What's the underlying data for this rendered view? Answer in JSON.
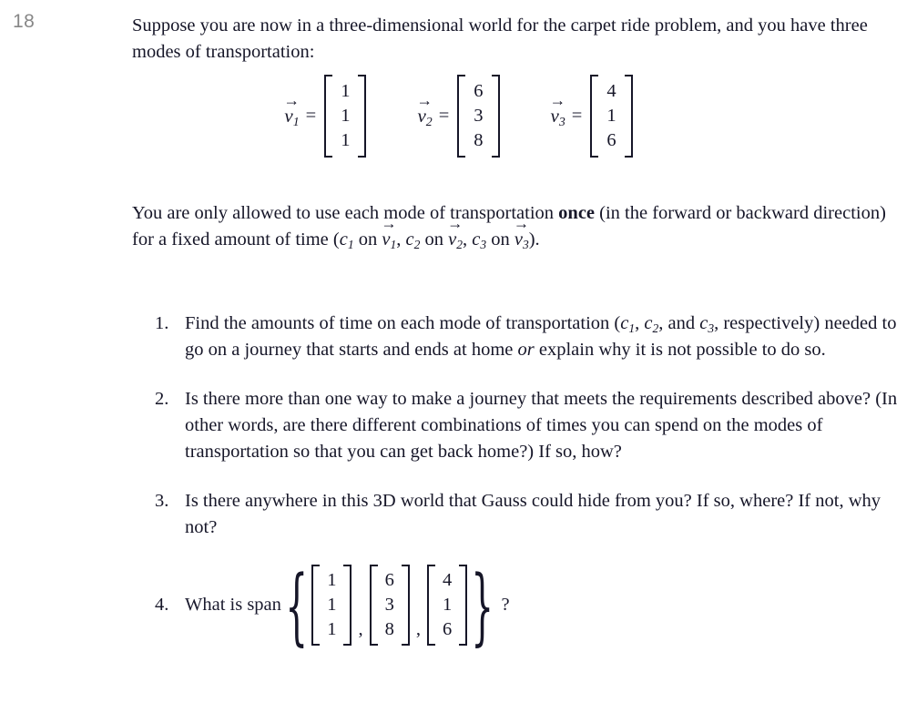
{
  "page": {
    "number": "18",
    "background": "#ffffff",
    "text_color": "#161628",
    "page_number_color": "#878787"
  },
  "intro": {
    "line1": "Suppose you are now in a three-dimensional world for the carpet ride problem, and you",
    "line2": "have three modes of transportation:"
  },
  "vectors": [
    {
      "label": "v",
      "subscript": "1",
      "equals": "=",
      "entries": [
        "1",
        "1",
        "1"
      ]
    },
    {
      "label": "v",
      "subscript": "2",
      "equals": "=",
      "entries": [
        "6",
        "3",
        "8"
      ]
    },
    {
      "label": "v",
      "subscript": "3",
      "equals": "=",
      "entries": [
        "4",
        "1",
        "6"
      ]
    }
  ],
  "rules": {
    "seg1": "You are only allowed to use each mode of transportation ",
    "bold_word": "once",
    "seg2": " (in the forward or backward direction) for a fixed amount of time (",
    "c1": "c",
    "c1_sub": "1",
    "on1": " on ",
    "v1": "v",
    "v1_sub": "1",
    "sep1": ", ",
    "c2": "c",
    "c2_sub": "2",
    "on2": " on ",
    "v2": "v",
    "v2_sub": "2",
    "sep2": ", ",
    "c3": "c",
    "c3_sub": "3",
    "on3": " on ",
    "v3": "v",
    "v3_sub": "3",
    "tail": ")."
  },
  "questions": [
    {
      "marker": "1.",
      "seg1": "Find the amounts of time on each mode of transportation (",
      "c1": "c",
      "c1_sub": "1",
      "sep1": ", ",
      "c2": "c",
      "c2_sub": "2",
      "sep2": ", and ",
      "c3": "c",
      "c3_sub": "3",
      "seg2": ", respectively) needed to go on a journey that starts and ends at home ",
      "italic_word": "or",
      "seg3": " explain why it is not possible to do so."
    },
    {
      "marker": "2.",
      "text": "Is there more than one way to make a journey that meets the requirements described above?  (In other words, are there different combinations of times you can spend on the modes of transportation so that you can get back home?)  If so, how?"
    },
    {
      "marker": "3.",
      "text": "Is there anywhere in this 3D world that Gauss could hide from you?  If so, where? If not, why not?"
    }
  ],
  "span_question": {
    "marker": "4.",
    "lead": "What is span",
    "open_brace": "{",
    "close_brace": "}",
    "comma": ",",
    "question_mark": "?",
    "sets": [
      {
        "entries": [
          "1",
          "1",
          "1"
        ]
      },
      {
        "entries": [
          "6",
          "3",
          "8"
        ]
      },
      {
        "entries": [
          "4",
          "1",
          "6"
        ]
      }
    ]
  }
}
